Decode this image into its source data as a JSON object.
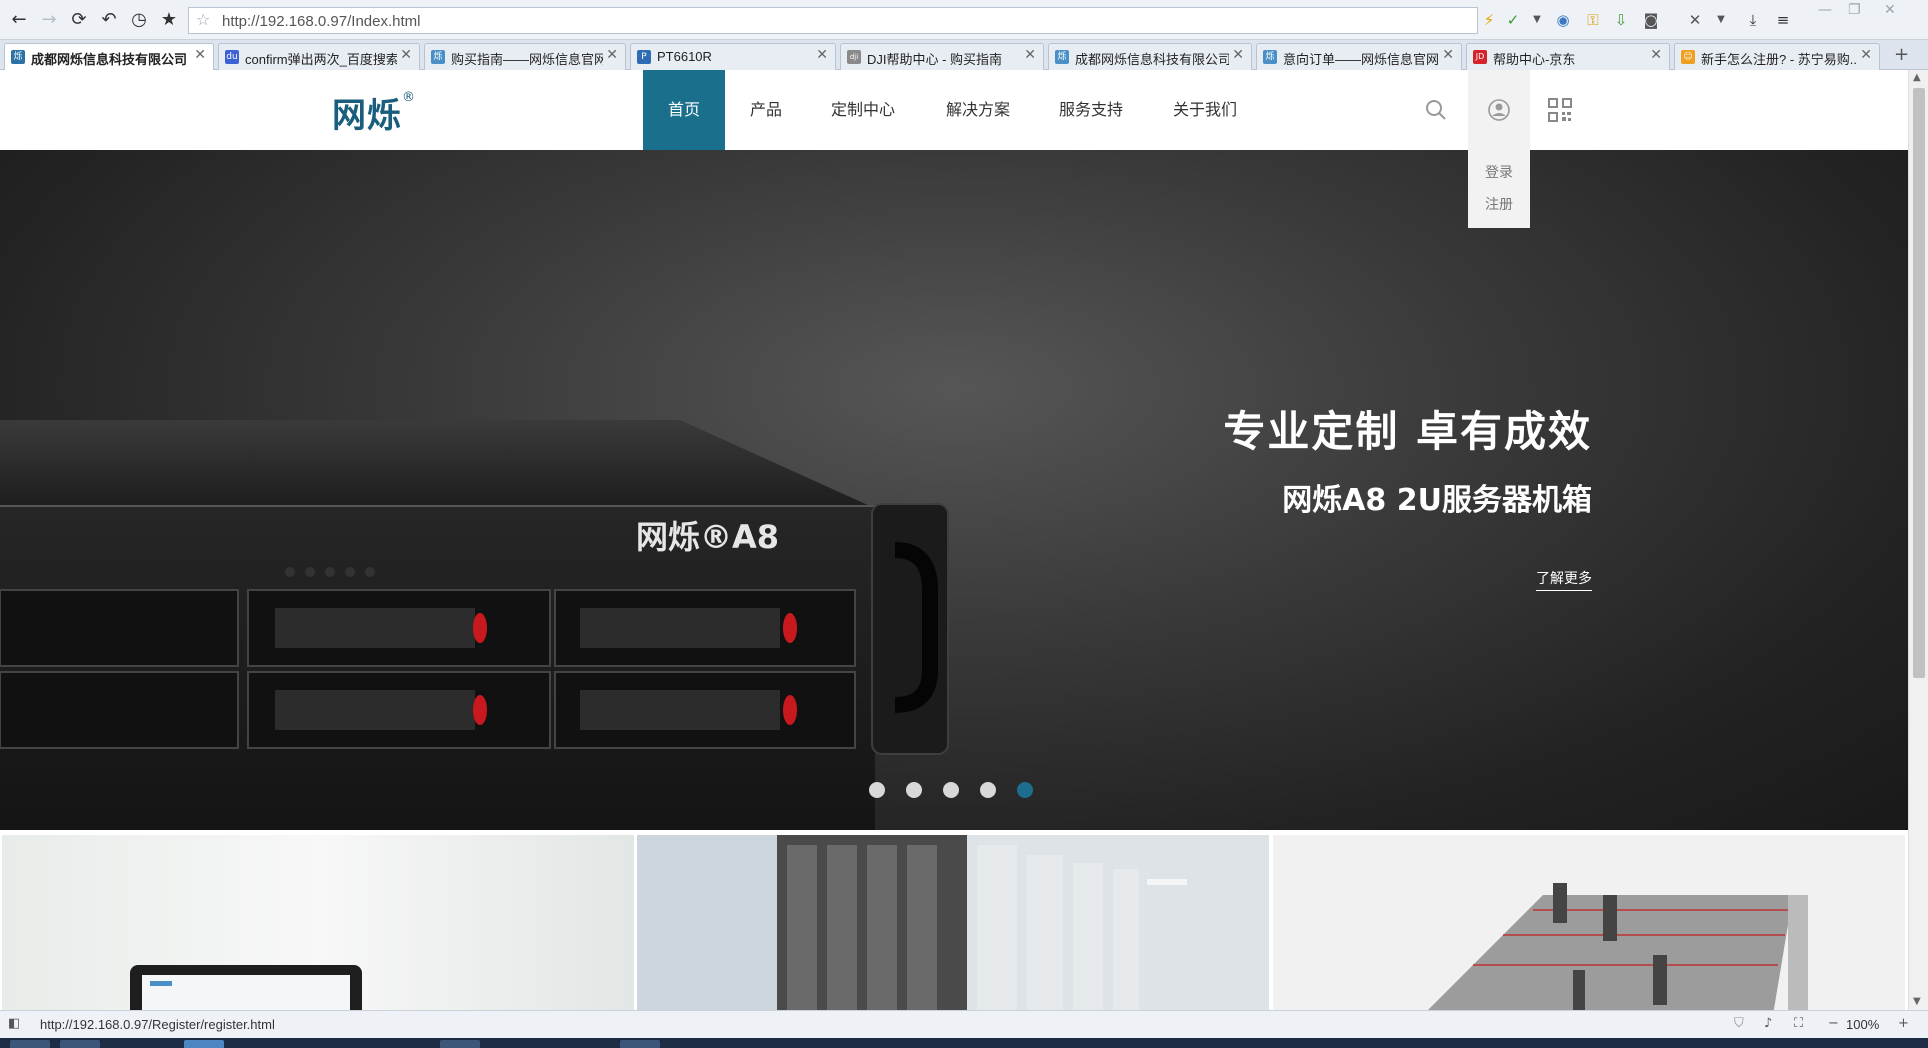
{
  "browser": {
    "url": "http://192.168.0.97/Index.html",
    "status_url": "http://192.168.0.97/Register/register.html",
    "zoom": "100%",
    "tabs": [
      {
        "title": "成都网烁信息科技有限公司",
        "icon": "烁",
        "icon_color": "#2b73a6"
      },
      {
        "title": "confirm弹出两次_百度搜索",
        "icon": "du",
        "icon_color": "#3c62d6"
      },
      {
        "title": "购买指南——网烁信息官网",
        "icon": "烁",
        "icon_color": "#4a8fc8"
      },
      {
        "title": "PT6610R",
        "icon": "P",
        "icon_color": "#2e6db4"
      },
      {
        "title": "DJI帮助中心 - 购买指南",
        "icon": "dji",
        "icon_color": "#8a8a8a"
      },
      {
        "title": "成都网烁信息科技有限公司 ...",
        "icon": "烁",
        "icon_color": "#4a8fc8"
      },
      {
        "title": "意向订单——网烁信息官网",
        "icon": "烁",
        "icon_color": "#4a8fc8"
      },
      {
        "title": "帮助中心-京东",
        "icon": "JD",
        "icon_color": "#d4242a"
      },
      {
        "title": "新手怎么注册? - 苏宁易购...",
        "icon": "☺",
        "icon_color": "#f0a020"
      }
    ]
  },
  "site": {
    "logo": "网烁",
    "logo_mark": "®",
    "nav": [
      "首页",
      "产品",
      "定制中心",
      "解决方案",
      "服务支持",
      "关于我们"
    ],
    "user_menu": {
      "login": "登录",
      "register": "注册"
    }
  },
  "hero": {
    "title": "专业定制 卓有成效",
    "subtitle": "网烁A8 2U服务器机箱",
    "more": "了解更多",
    "product_badge": "网烁®A8",
    "slide_count": 5,
    "active_slide": 5
  },
  "colors": {
    "brand": "#1a6f8c",
    "dot_active": "#1d6e8e"
  }
}
